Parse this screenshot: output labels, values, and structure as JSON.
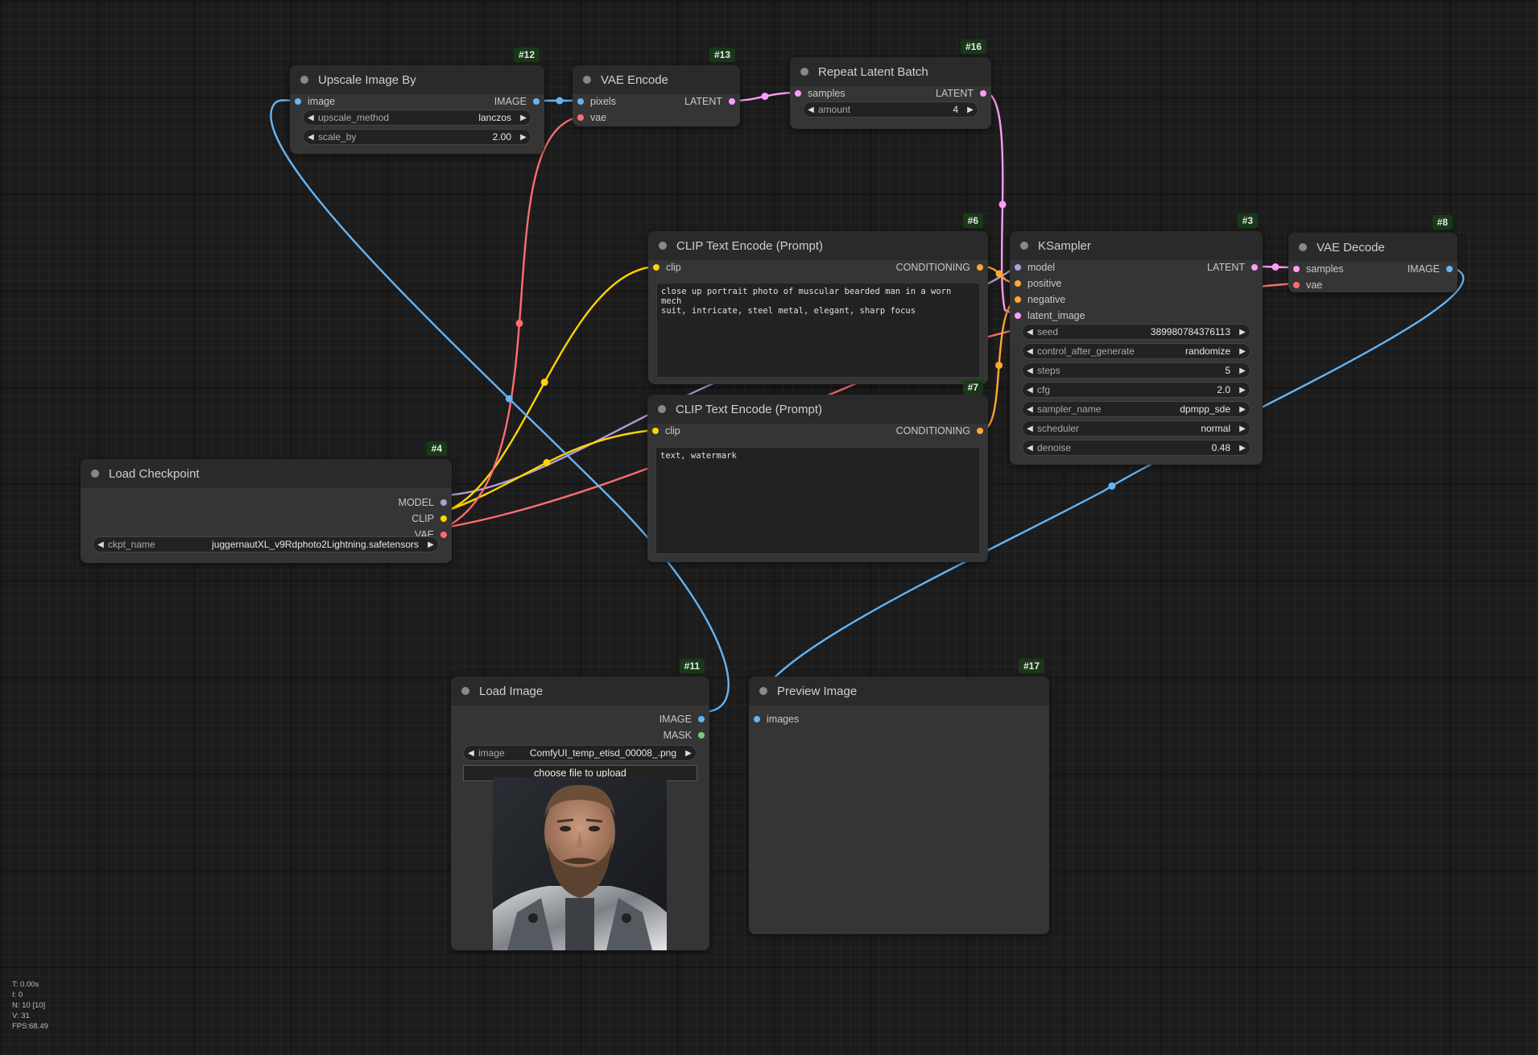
{
  "colors": {
    "image": "#64b5f6",
    "latent": "#ff9cf9",
    "vae": "#ff6e6e",
    "clip": "#ffd500",
    "conditioning": "#ffa931",
    "model": "#b39ddb",
    "mask": "#81c784"
  },
  "nodes": {
    "upscale": {
      "id": "#12",
      "title": "Upscale Image By",
      "in_image": "image",
      "out_image": "IMAGE",
      "upscale_method_label": "upscale_method",
      "upscale_method_value": "lanczos",
      "scale_by_label": "scale_by",
      "scale_by_value": "2.00"
    },
    "vae_encode": {
      "id": "#13",
      "title": "VAE Encode",
      "in_pixels": "pixels",
      "in_vae": "vae",
      "out_latent": "LATENT"
    },
    "repeat_latent": {
      "id": "#16",
      "title": "Repeat Latent Batch",
      "in_samples": "samples",
      "out_latent": "LATENT",
      "amount_label": "amount",
      "amount_value": "4"
    },
    "clip_pos": {
      "id": "#6",
      "title": "CLIP Text Encode (Prompt)",
      "in_clip": "clip",
      "out_conditioning": "CONDITIONING",
      "text": "close up portrait photo of muscular bearded man in a worn mech\nsuit, intricate, steel metal, elegant, sharp focus"
    },
    "clip_neg": {
      "id": "#7",
      "title": "CLIP Text Encode (Prompt)",
      "in_clip": "clip",
      "out_conditioning": "CONDITIONING",
      "text": "text, watermark"
    },
    "ksampler": {
      "id": "#3",
      "title": "KSampler",
      "in_model": "model",
      "in_positive": "positive",
      "in_negative": "negative",
      "in_latent": "latent_image",
      "out_latent": "LATENT",
      "widgets": [
        {
          "label": "seed",
          "value": "389980784376113"
        },
        {
          "label": "control_after_generate",
          "value": "randomize"
        },
        {
          "label": "steps",
          "value": "5"
        },
        {
          "label": "cfg",
          "value": "2.0"
        },
        {
          "label": "sampler_name",
          "value": "dpmpp_sde"
        },
        {
          "label": "scheduler",
          "value": "normal"
        },
        {
          "label": "denoise",
          "value": "0.48"
        }
      ]
    },
    "vae_decode": {
      "id": "#8",
      "title": "VAE Decode",
      "in_samples": "samples",
      "in_vae": "vae",
      "out_image": "IMAGE"
    },
    "load_checkpoint": {
      "id": "#4",
      "title": "Load Checkpoint",
      "out_model": "MODEL",
      "out_clip": "CLIP",
      "out_vae": "VAE",
      "ckpt_label": "ckpt_name",
      "ckpt_value": "juggernautXL_v9Rdphoto2Lightning.safetensors"
    },
    "load_image": {
      "id": "#11",
      "title": "Load Image",
      "out_image": "IMAGE",
      "out_mask": "MASK",
      "image_label": "image",
      "image_value": "ComfyUI_temp_etisd_00008_.png",
      "upload_label": "choose file to upload"
    },
    "preview": {
      "id": "#17",
      "title": "Preview Image",
      "in_images": "images"
    }
  },
  "stats": [
    "T: 0.00s",
    "I: 0",
    "N: 10 [10]",
    "V: 31",
    "FPS:68.49"
  ]
}
